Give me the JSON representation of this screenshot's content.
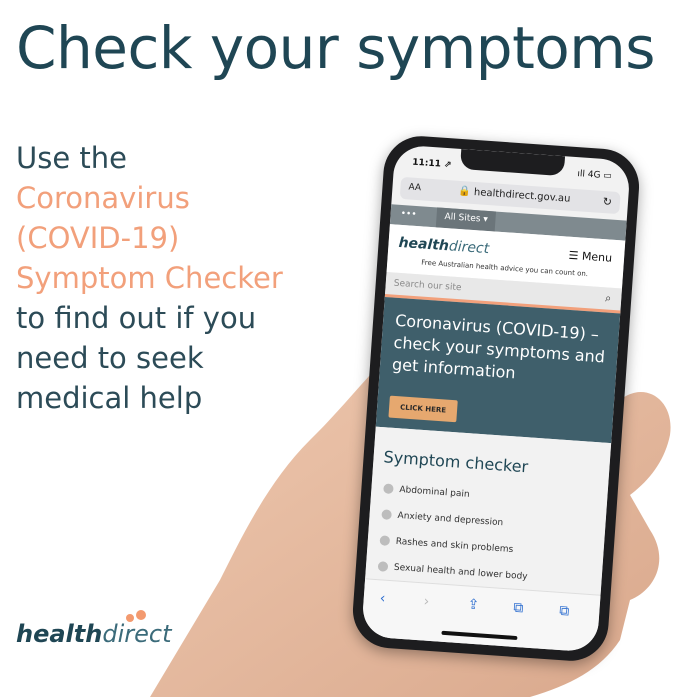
{
  "headline": "Check your symptoms",
  "promo": {
    "line1": "Use the",
    "accent1": "Coronavirus",
    "accent2": "(COVID-19)",
    "accent3": "Symptom Checker",
    "line5": "to find out if you",
    "line6": "need to seek",
    "line7": "medical help"
  },
  "brand": {
    "part1": "health",
    "part2": "direct"
  },
  "phone": {
    "status_time": "11:11 ⇗",
    "status_signal": "ıll 4G ▭",
    "url_aa": "AA",
    "url": "🔒 healthdirect.gov.au",
    "reload_icon": "↻",
    "nav_home": "•••",
    "nav_sites": "All Sites ▾",
    "site_logo_1": "health",
    "site_logo_2": "direct",
    "menu": "☰ Menu",
    "tagline": "Free Australian health advice you can count on.",
    "search_placeholder": "Search our site",
    "search_icon": "⌕",
    "hero_title": "Coronavirus (COVID-19) – check your symptoms and get information",
    "hero_cta": "CLICK HERE",
    "checker_heading": "Symptom checker",
    "checker_items": [
      "Abdominal pain",
      "Anxiety and depression",
      "Rashes and skin problems",
      "Sexual health and lower body"
    ],
    "toolbar_icons": [
      "‹",
      "›",
      "⇪",
      "⧉",
      "⧉"
    ]
  },
  "colors": {
    "navy": "#1f4654",
    "accent": "#f2a07b",
    "hero": "#3f5f6b"
  }
}
